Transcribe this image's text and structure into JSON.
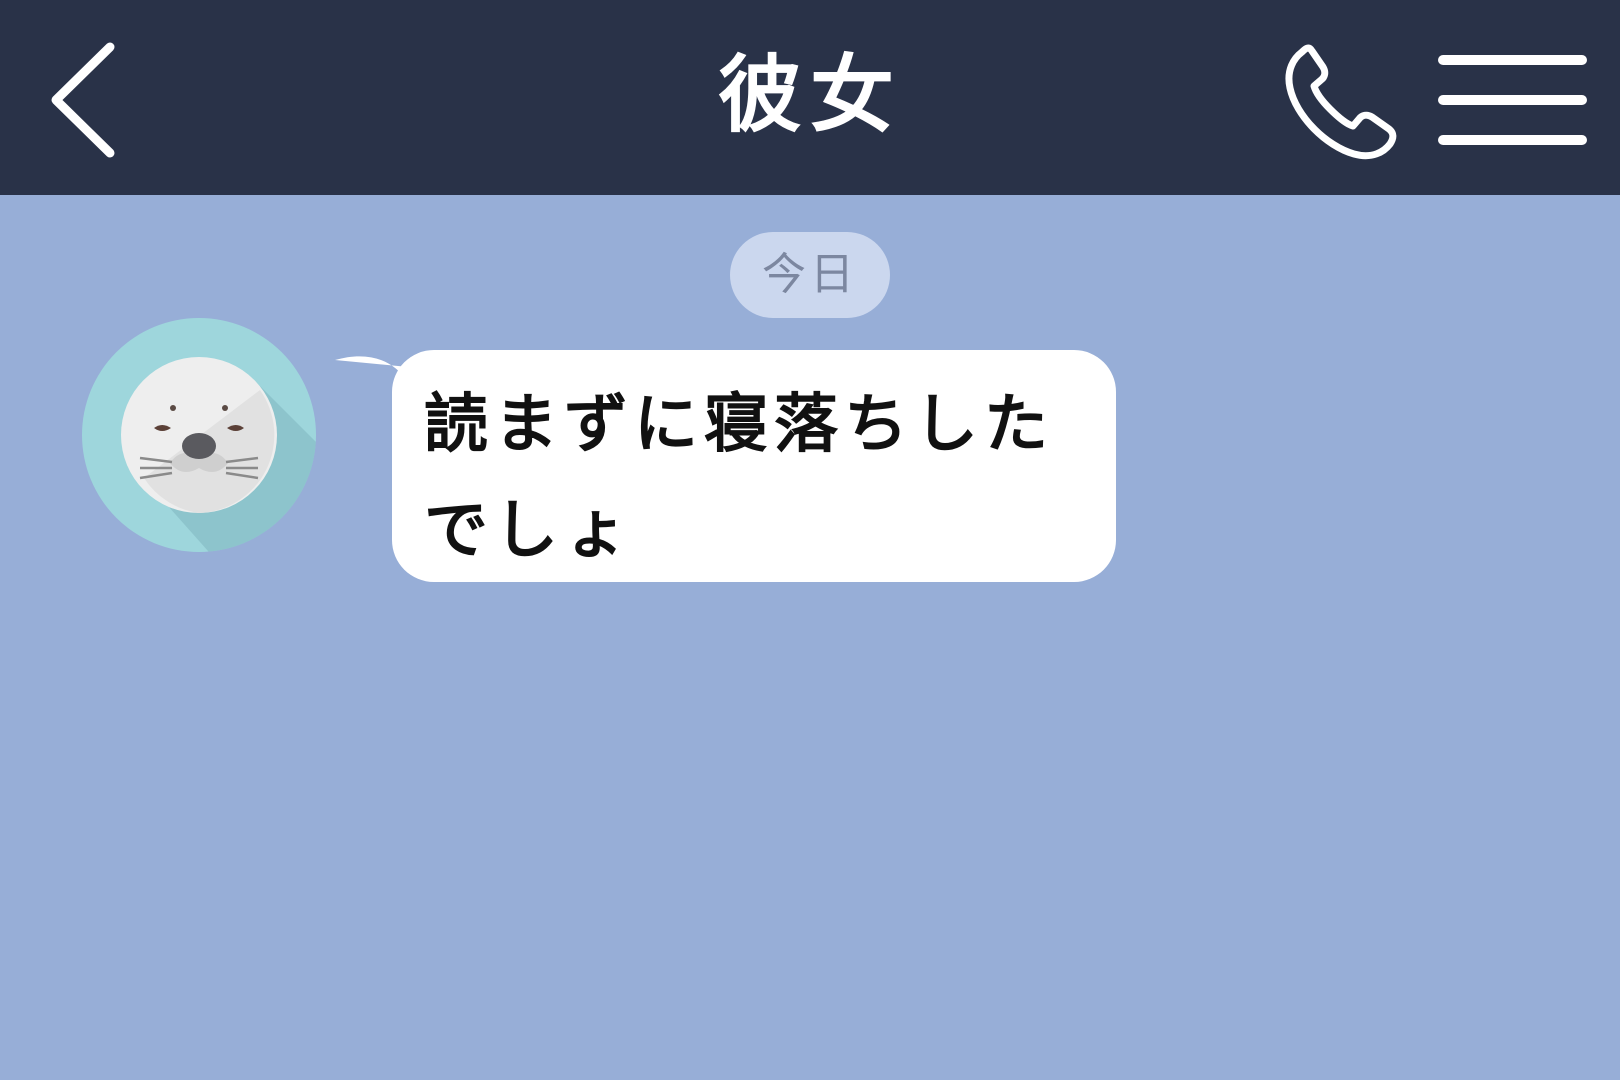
{
  "header": {
    "title": "彼女",
    "back_icon": "chevron-left-icon",
    "call_icon": "phone-icon",
    "menu_icon": "hamburger-menu-icon"
  },
  "chat": {
    "date_label": "今日",
    "messages": [
      {
        "sender": "other",
        "avatar_icon": "seal-avatar-icon",
        "lines": [
          "読まずに寝落ちした",
          "でしょ"
        ]
      }
    ]
  },
  "colors": {
    "header_bg": "#293248",
    "chat_bg": "#97aed7",
    "date_pill_bg": "#cbd7ee",
    "bubble_bg": "#ffffff",
    "avatar_ring": "#9ed6dc"
  }
}
